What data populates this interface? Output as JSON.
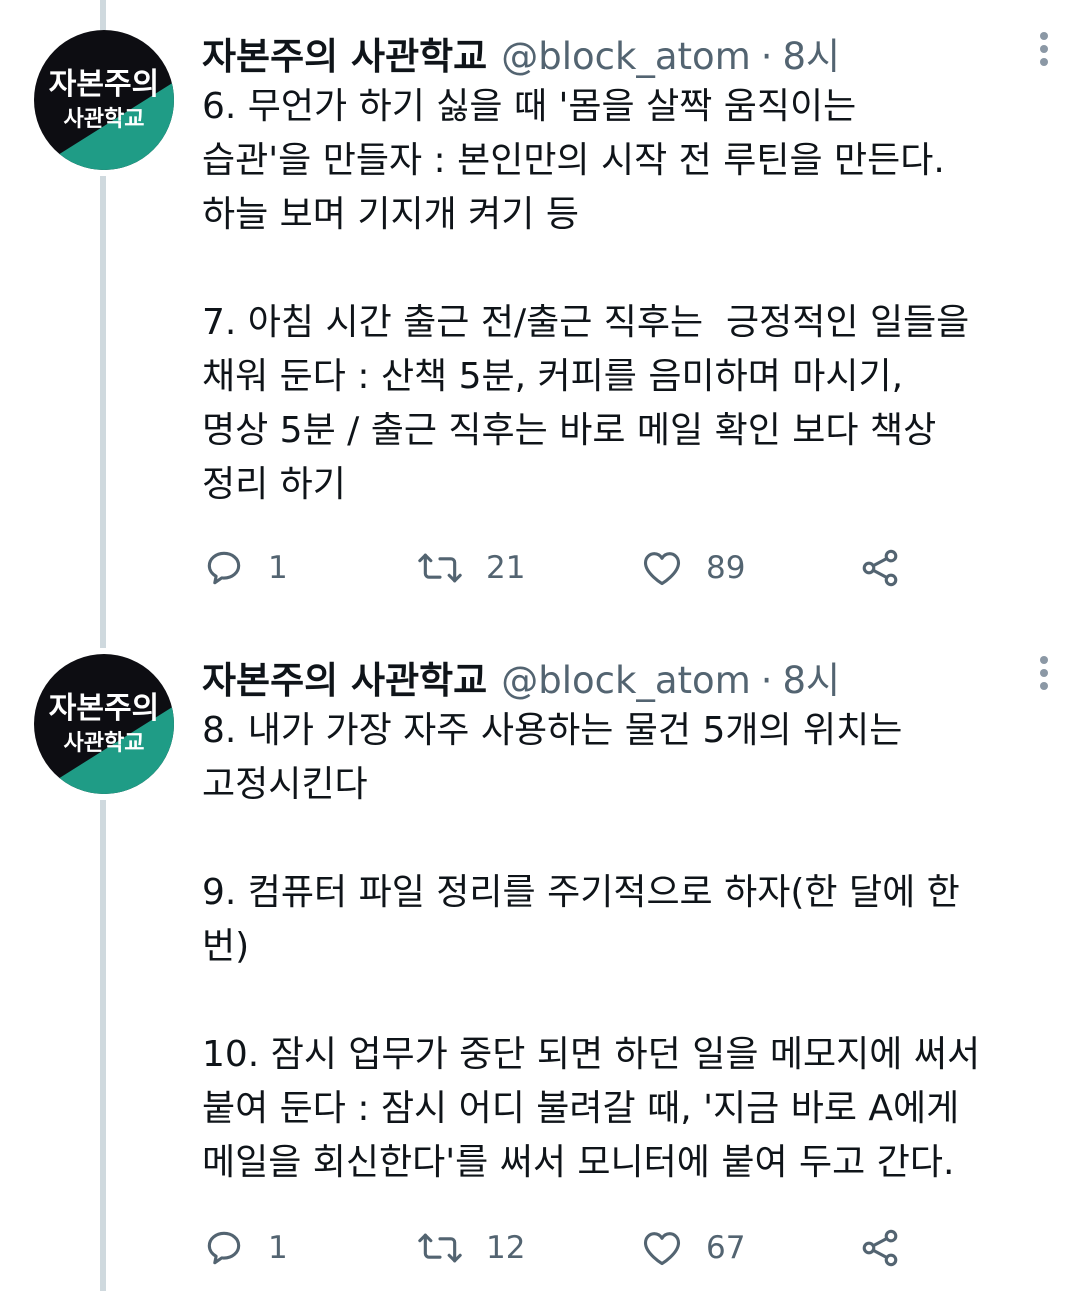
{
  "tweets": [
    {
      "author": {
        "display_name": "자본주의 사관학교",
        "handle": "@block_atom",
        "avatar_text_top": "자본주의",
        "avatar_text_bottom": "사관학교"
      },
      "separator": "·",
      "time": "8시",
      "text": "6. 무언가 하기 싫을 때 '몸을 살짝 움직이는\n습관'을 만들자 : 본인만의 시작 전 루틴을 만든다.\n하늘 보며 기지개 켜기 등\n\n7. 아침 시간 출근 전/출근 직후는  긍정적인 일들을\n채워 둔다 : 산책 5분, 커피를 음미하며 마시기,\n명상 5분 / 출근 직후는 바로 메일 확인 보다 책상\n정리 하기",
      "stats": {
        "replies": "1",
        "retweets": "21",
        "likes": "89"
      }
    },
    {
      "author": {
        "display_name": "자본주의 사관학교",
        "handle": "@block_atom",
        "avatar_text_top": "자본주의",
        "avatar_text_bottom": "사관학교"
      },
      "separator": "·",
      "time": "8시",
      "text": "8. 내가 가장 자주 사용하는 물건 5개의 위치는\n고정시킨다\n\n9. 컴퓨터 파일 정리를 주기적으로 하자(한 달에 한\n번)\n\n10. 잠시 업무가 중단 되면 하던 일을 메모지에 써서\n붙여 둔다 : 잠시 어디 불려갈 때, '지금 바로 A에게\n메일을 회신한다'를 써서 모니터에 붙여 두고 간다.",
      "stats": {
        "replies": "1",
        "retweets": "12",
        "likes": "67"
      }
    }
  ],
  "icons": {
    "reply": "reply-icon",
    "retweet": "retweet-icon",
    "like": "heart-icon",
    "share": "share-icon",
    "more": "more-vertical-icon"
  },
  "colors": {
    "avatar_dark": "#0d0d12",
    "avatar_teal": "#1f9c86",
    "muted": "#536471",
    "thread_line": "#cfd9de"
  }
}
